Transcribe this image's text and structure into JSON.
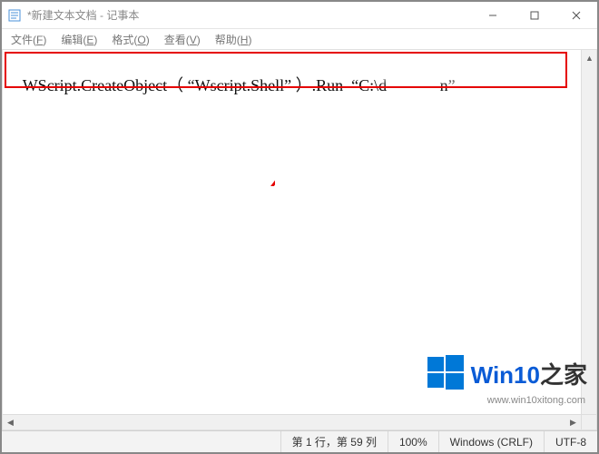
{
  "window": {
    "title": "*新建文本文档 - 记事本"
  },
  "menu": {
    "file": {
      "label": "文件",
      "key": "F"
    },
    "edit": {
      "label": "编辑",
      "key": "E"
    },
    "format": {
      "label": "格式",
      "key": "O"
    },
    "view": {
      "label": "查看",
      "key": "V"
    },
    "help": {
      "label": "帮助",
      "key": "H"
    }
  },
  "content": {
    "line1": "WScript.CreateObject（ “Wscript.Shell” ）.Run  “C:\\d             n”"
  },
  "status": {
    "position": "第 1 行，第 59 列",
    "zoom": "100%",
    "encoding": "Windows (CRLF)",
    "eol": "UTF-8"
  },
  "watermark": {
    "brand": "Win10",
    "suffix": "之家",
    "url": "www.win10xitong.com"
  },
  "colors": {
    "highlight": "#e50000",
    "brand_blue": "#0a5bd6"
  }
}
